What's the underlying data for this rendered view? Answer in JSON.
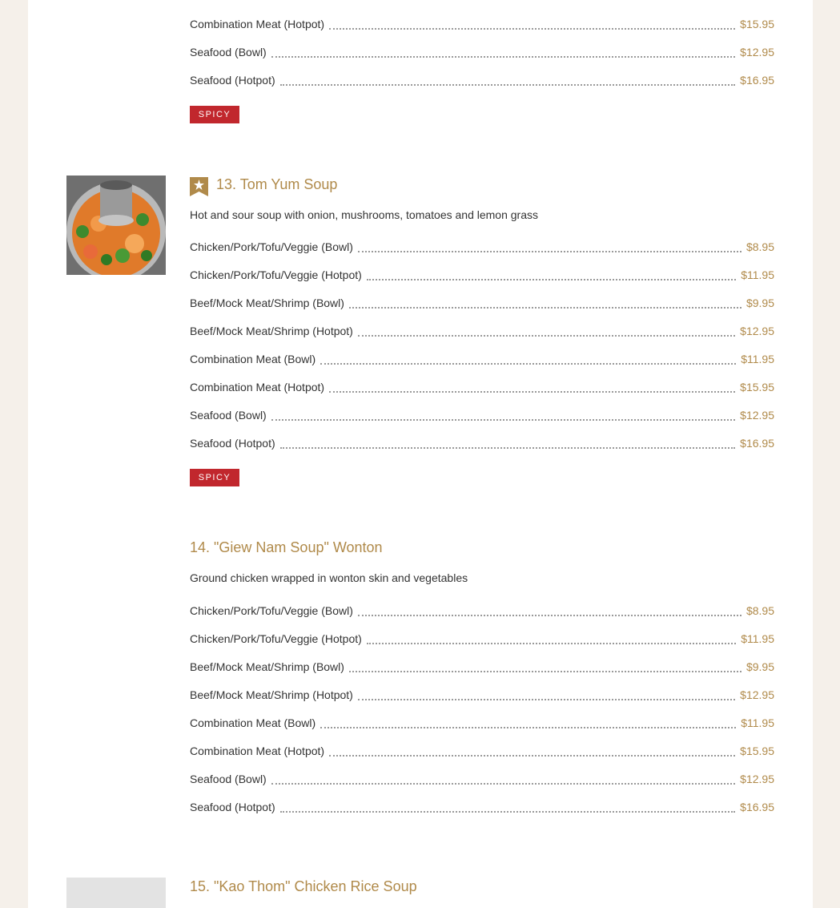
{
  "colors": {
    "accent": "#b08a4a",
    "spicy": "#c1272d",
    "text": "#333333",
    "background": "#f5f0ea"
  },
  "sections": [
    {
      "items": [
        {
          "name": "Combination Meat (Hotpot)",
          "price": "$15.95"
        },
        {
          "name": "Seafood (Bowl)",
          "price": "$12.95"
        },
        {
          "name": "Seafood (Hotpot)",
          "price": "$16.95"
        }
      ],
      "spicy_label": "SPICY"
    },
    {
      "title": "13. Tom Yum Soup",
      "badge_icon": "star-bookmark-icon",
      "description": "Hot and sour soup with onion, mushrooms, tomatoes and lemon grass",
      "items": [
        {
          "name": "Chicken/Pork/Tofu/Veggie (Bowl)",
          "price": "$8.95"
        },
        {
          "name": "Chicken/Pork/Tofu/Veggie (Hotpot)",
          "price": "$11.95"
        },
        {
          "name": "Beef/Mock Meat/Shrimp (Bowl)",
          "price": "$9.95"
        },
        {
          "name": "Beef/Mock Meat/Shrimp (Hotpot)",
          "price": "$12.95"
        },
        {
          "name": "Combination Meat (Bowl)",
          "price": "$11.95"
        },
        {
          "name": "Combination Meat (Hotpot)",
          "price": "$15.95"
        },
        {
          "name": "Seafood (Bowl)",
          "price": "$12.95"
        },
        {
          "name": "Seafood (Hotpot)",
          "price": "$16.95"
        }
      ],
      "spicy_label": "SPICY"
    },
    {
      "title": "14. \"Giew Nam Soup\" Wonton",
      "description": "Ground chicken wrapped in wonton skin and vegetables",
      "items": [
        {
          "name": "Chicken/Pork/Tofu/Veggie (Bowl)",
          "price": "$8.95"
        },
        {
          "name": "Chicken/Pork/Tofu/Veggie (Hotpot)",
          "price": "$11.95"
        },
        {
          "name": "Beef/Mock Meat/Shrimp (Bowl)",
          "price": "$9.95"
        },
        {
          "name": "Beef/Mock Meat/Shrimp (Hotpot)",
          "price": "$12.95"
        },
        {
          "name": "Combination Meat (Bowl)",
          "price": "$11.95"
        },
        {
          "name": "Combination Meat (Hotpot)",
          "price": "$15.95"
        },
        {
          "name": "Seafood (Bowl)",
          "price": "$12.95"
        },
        {
          "name": "Seafood (Hotpot)",
          "price": "$16.95"
        }
      ]
    },
    {
      "title": "15. \"Kao Thom\" Chicken Rice Soup"
    }
  ]
}
